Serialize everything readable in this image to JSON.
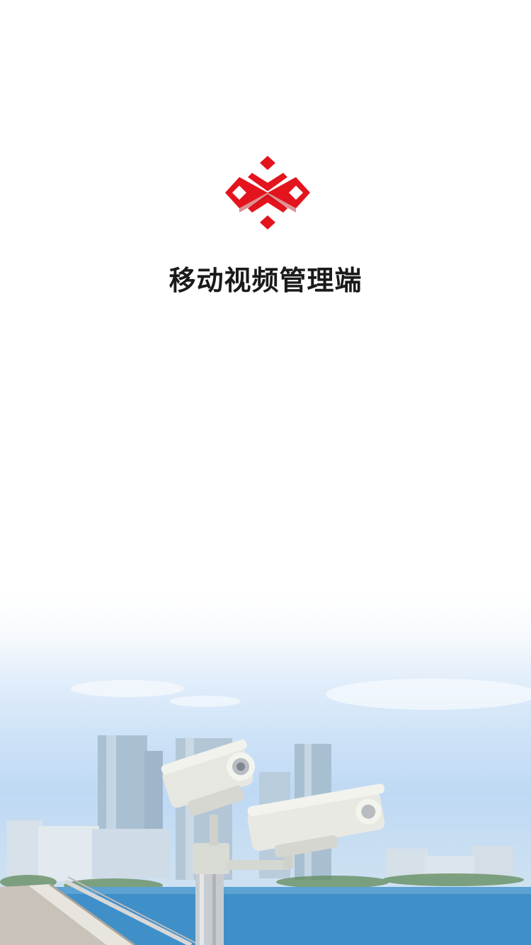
{
  "app": {
    "title": "移动视频管理端",
    "logo_icon": "brand-logo-icon",
    "brand_color": "#e3141d"
  },
  "background": {
    "illustration": "city-skyline-with-security-cameras",
    "sky_color": "#bfd9f4",
    "water_color": "#3f8fc9"
  }
}
